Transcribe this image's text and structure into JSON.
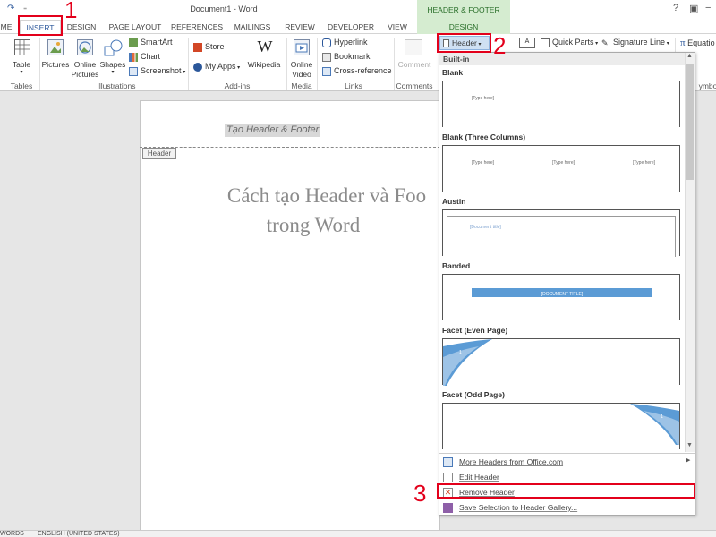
{
  "window": {
    "title": "Document1 - Word",
    "contextual_tab_group": "HEADER & FOOTER TOOLS",
    "controls": [
      "?",
      "▣",
      "−",
      "▢"
    ]
  },
  "tabs": [
    "ME",
    "INSERT",
    "DESIGN",
    "PAGE LAYOUT",
    "REFERENCES",
    "MAILINGS",
    "REVIEW",
    "DEVELOPER",
    "VIEW",
    "DESIGN"
  ],
  "ribbon": {
    "tables": {
      "button": "Table",
      "group": "Tables"
    },
    "illustrations": {
      "pictures": "Pictures",
      "online_pictures_1": "Online",
      "online_pictures_2": "Pictures",
      "shapes": "Shapes",
      "smartart": "SmartArt",
      "chart": "Chart",
      "screenshot": "Screenshot",
      "group": "Illustrations"
    },
    "addins": {
      "store": "Store",
      "my_apps": "My Apps",
      "wikipedia": "Wikipedia",
      "group": "Add-ins"
    },
    "media": {
      "online_video_1": "Online",
      "online_video_2": "Video",
      "group": "Media"
    },
    "links": {
      "hyperlink": "Hyperlink",
      "bookmark": "Bookmark",
      "cross_reference": "Cross-reference",
      "group": "Links"
    },
    "comments": {
      "comment": "Comment",
      "group": "Comments"
    },
    "header_footer": {
      "header": "Header"
    },
    "text": {
      "quick_parts": "Quick Parts",
      "signature_line": "Signature Line"
    },
    "symbols": {
      "equation": "Equatio",
      "group": "ymbo"
    }
  },
  "document": {
    "header_text": "Tạo Header & Footer",
    "header_tag": "Header",
    "title_line1": "Cách tạo Header và Foo",
    "title_line2": "trong Word"
  },
  "gallery": {
    "section": "Built-in",
    "items": [
      {
        "name": "Blank",
        "placeholders": [
          "[Type here]"
        ]
      },
      {
        "name": "Blank (Three Columns)",
        "placeholders": [
          "[Type here]",
          "[Type here]",
          "[Type here]"
        ]
      },
      {
        "name": "Austin",
        "placeholders": [
          "[Document title]"
        ]
      },
      {
        "name": "Banded",
        "placeholders": [
          "[DOCUMENT TITLE]"
        ]
      },
      {
        "name": "Facet (Even Page)",
        "placeholders": [
          "1"
        ]
      },
      {
        "name": "Facet (Odd Page)",
        "placeholders": [
          "1"
        ]
      }
    ],
    "menu": [
      {
        "label": "More Headers from Office.com",
        "icon": "office-globe-icon",
        "has_submenu": true
      },
      {
        "label": "Edit Header",
        "icon": "edit-header-icon"
      },
      {
        "label": "Remove Header",
        "icon": "remove-header-icon"
      },
      {
        "label": "Save Selection to Header Gallery...",
        "icon": "save-selection-icon"
      }
    ]
  },
  "status_bar": {
    "words": "WORDS",
    "language": "ENGLISH (UNITED STATES)"
  },
  "annotations": [
    "1",
    "2",
    "3"
  ],
  "colors": {
    "annotation_red": "#e3001b",
    "accent_blue": "#2b579a",
    "contextual_green": "#d5ecd0",
    "banded_blue": "#5b9bd5"
  }
}
